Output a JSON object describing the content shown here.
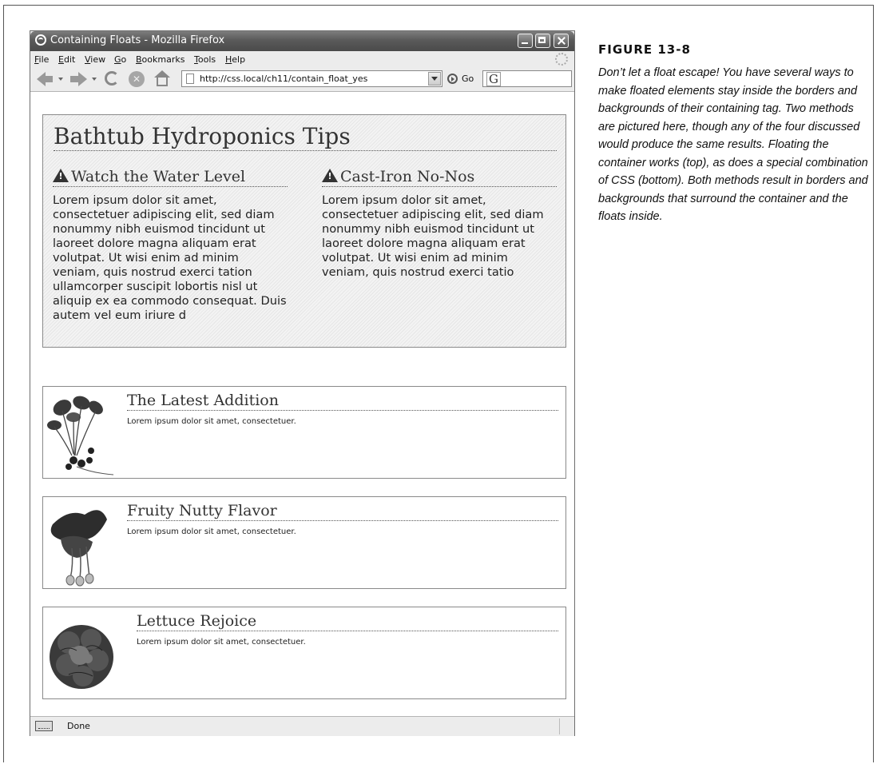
{
  "window": {
    "title": "Containing Floats - Mozilla Firefox",
    "menus": [
      "File",
      "Edit",
      "View",
      "Go",
      "Bookmarks",
      "Tools",
      "Help"
    ],
    "url": "http://css.local/ch11/contain_float_yes",
    "go_label": "Go",
    "search_engine_glyph": "G",
    "status": "Done"
  },
  "page": {
    "heading": "Bathtub Hydroponics Tips",
    "columns": [
      {
        "heading": "Watch the Water Level",
        "text": "Lorem ipsum dolor sit amet, consectetuer adipiscing elit, sed diam nonummy nibh euismod tincidunt ut laoreet dolore magna aliquam erat volutpat. Ut wisi enim ad minim veniam, quis nostrud exerci tation ullamcorper suscipit lobortis nisl ut aliquip ex ea commodo consequat. Duis autem vel eum iriure d"
      },
      {
        "heading": "Cast-Iron No-Nos",
        "text": "Lorem ipsum dolor sit amet, consectetuer adipiscing elit, sed diam nonummy nibh euismod tincidunt ut laoreet dolore magna aliquam erat volutpat. Ut wisi enim ad minim veniam, quis nostrud exerci tatio"
      }
    ],
    "items": [
      {
        "heading": "The Latest Addition",
        "text": "Lorem ipsum dolor sit amet, consectetuer.",
        "image": "radish-bunch-image"
      },
      {
        "heading": "Fruity Nutty Flavor",
        "text": "Lorem ipsum dolor sit amet, consectetuer.",
        "image": "leafy-greens-image"
      },
      {
        "heading": "Lettuce Rejoice",
        "text": "Lorem ipsum dolor sit amet, consectetuer.",
        "image": "lettuce-head-image"
      }
    ]
  },
  "caption": {
    "label": "FIGURE 13-8",
    "text": "Don’t let a float escape! You have several ways to make floated elements stay inside the borders and backgrounds of their containing tag. Two methods are pictured here, though any of the four discussed would produce the same results. Floating the container works (top), as does a special combination of CSS (bottom). Both methods result in borders and backgrounds that surround the container and the floats inside."
  }
}
